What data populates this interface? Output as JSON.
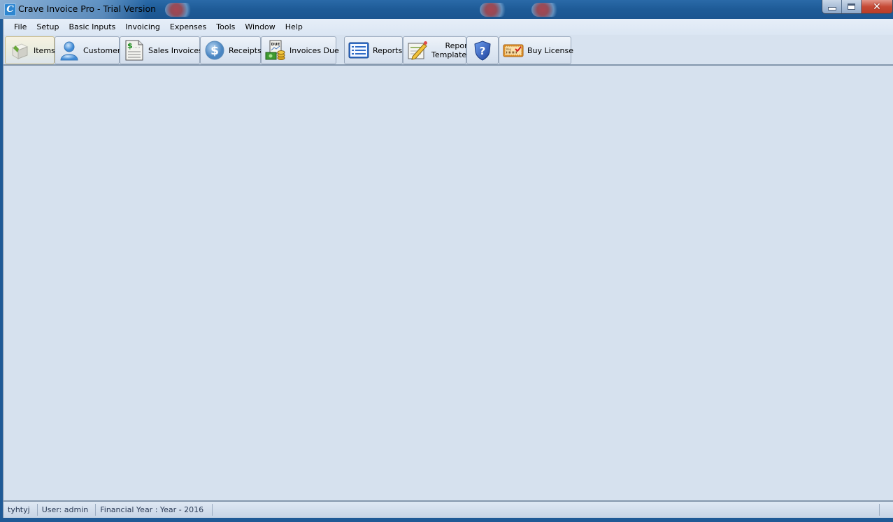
{
  "window": {
    "title": "Crave Invoice Pro - Trial Version",
    "app_icon_glyph": "C",
    "controls": {
      "minimize": "minimize-icon",
      "maximize": "restore-icon",
      "close": "close-icon"
    }
  },
  "menu": {
    "items": [
      "File",
      "Setup",
      "Basic Inputs",
      "Invoicing",
      "Expenses",
      "Tools",
      "Window",
      "Help"
    ]
  },
  "toolbar": {
    "buttons": [
      {
        "label": "Items",
        "icon": "box-icon",
        "active": true
      },
      {
        "label": "Customers",
        "icon": "user-icon"
      },
      {
        "label": "Sales Invoices",
        "icon": "invoice-document-icon"
      },
      {
        "label": "Receipts",
        "icon": "dollar-coin-icon"
      },
      {
        "label": "Invoices Due",
        "icon": "due-money-icon"
      },
      {
        "label": "Reports",
        "icon": "report-list-icon"
      },
      {
        "label_line1": "Report",
        "label_line2": "Templates",
        "icon": "template-pencil-icon"
      },
      {
        "label": "",
        "icon": "help-shield-icon"
      },
      {
        "label": "Buy License",
        "icon": "license-ticket-icon"
      }
    ]
  },
  "status": {
    "company": "tyhtyj",
    "user": "User: admin",
    "financial_year": "Financial Year : Year - 2016"
  },
  "colors": {
    "titlebar": "#1e5b97",
    "workspace": "#d6e1ee",
    "close_button": "#c64a35"
  }
}
